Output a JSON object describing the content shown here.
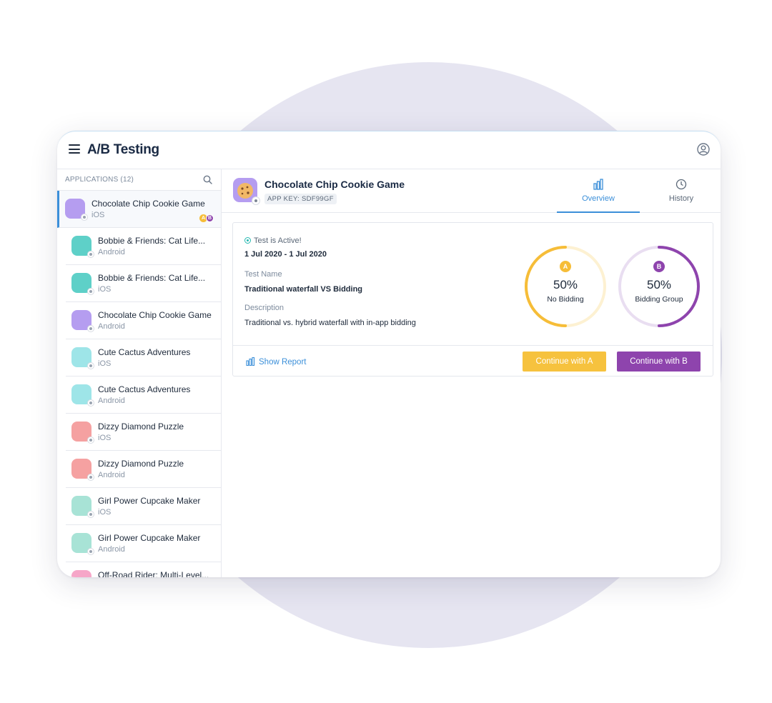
{
  "header": {
    "title": "A/B Testing"
  },
  "sidebar": {
    "heading": "APPLICATIONS (12)",
    "items": [
      {
        "name": "Chocolate Chip Cookie Game",
        "platform": "iOS",
        "color": "#b59df0",
        "active": true,
        "badges": [
          "A",
          "B"
        ]
      },
      {
        "name": "Bobbie & Friends: Cat Life...",
        "platform": "Android",
        "color": "#5ed0c8"
      },
      {
        "name": "Bobbie & Friends: Cat Life...",
        "platform": "iOS",
        "color": "#5ed0c8"
      },
      {
        "name": "Chocolate Chip Cookie Game",
        "platform": "Android",
        "color": "#b59df0"
      },
      {
        "name": "Cute Cactus Adventures",
        "platform": "iOS",
        "color": "#9ee5e8"
      },
      {
        "name": "Cute Cactus Adventures",
        "platform": "Android",
        "color": "#9ee5e8"
      },
      {
        "name": "Dizzy Diamond Puzzle",
        "platform": "iOS",
        "color": "#f5a1a1"
      },
      {
        "name": "Dizzy Diamond Puzzle",
        "platform": "Android",
        "color": "#f5a1a1"
      },
      {
        "name": "Girl Power Cupcake Maker",
        "platform": "iOS",
        "color": "#a8e3d6"
      },
      {
        "name": "Girl Power Cupcake Maker",
        "platform": "Android",
        "color": "#a8e3d6"
      },
      {
        "name": "Off-Road Rider: Multi-Level...",
        "platform": "",
        "color": "#f6a6c8"
      }
    ]
  },
  "main": {
    "app_name": "Chocolate Chip Cookie Game",
    "app_key": "APP KEY: SDF99GF",
    "tabs": {
      "overview": "Overview",
      "history": "History"
    },
    "test": {
      "status": "Test is Active!",
      "date_range": "1 Jul 2020 - 1 Jul 2020",
      "name_label": "Test Name",
      "name_value": "Traditional waterfall VS Bidding",
      "desc_label": "Description",
      "desc_value": "Traditional vs. hybrid waterfall with in-app bidding"
    },
    "groups": {
      "a": {
        "badge": "A",
        "percent": "50%",
        "fraction": 0.5,
        "caption": "No Bidding",
        "color": "#f6bd38",
        "track": "#fdf1d2"
      },
      "b": {
        "badge": "B",
        "percent": "50%",
        "fraction": 0.5,
        "caption": "Bidding Group",
        "color": "#8e44ad",
        "track": "#e9def1"
      }
    },
    "actions": {
      "show_report": "Show Report",
      "continue_a": "Continue with A",
      "continue_b": "Continue with B"
    }
  },
  "colors": {
    "accent": "#3b8fd9",
    "group_a": "#f6c23e",
    "group_b": "#8e44ad",
    "active_dot": "#25b8b0"
  }
}
